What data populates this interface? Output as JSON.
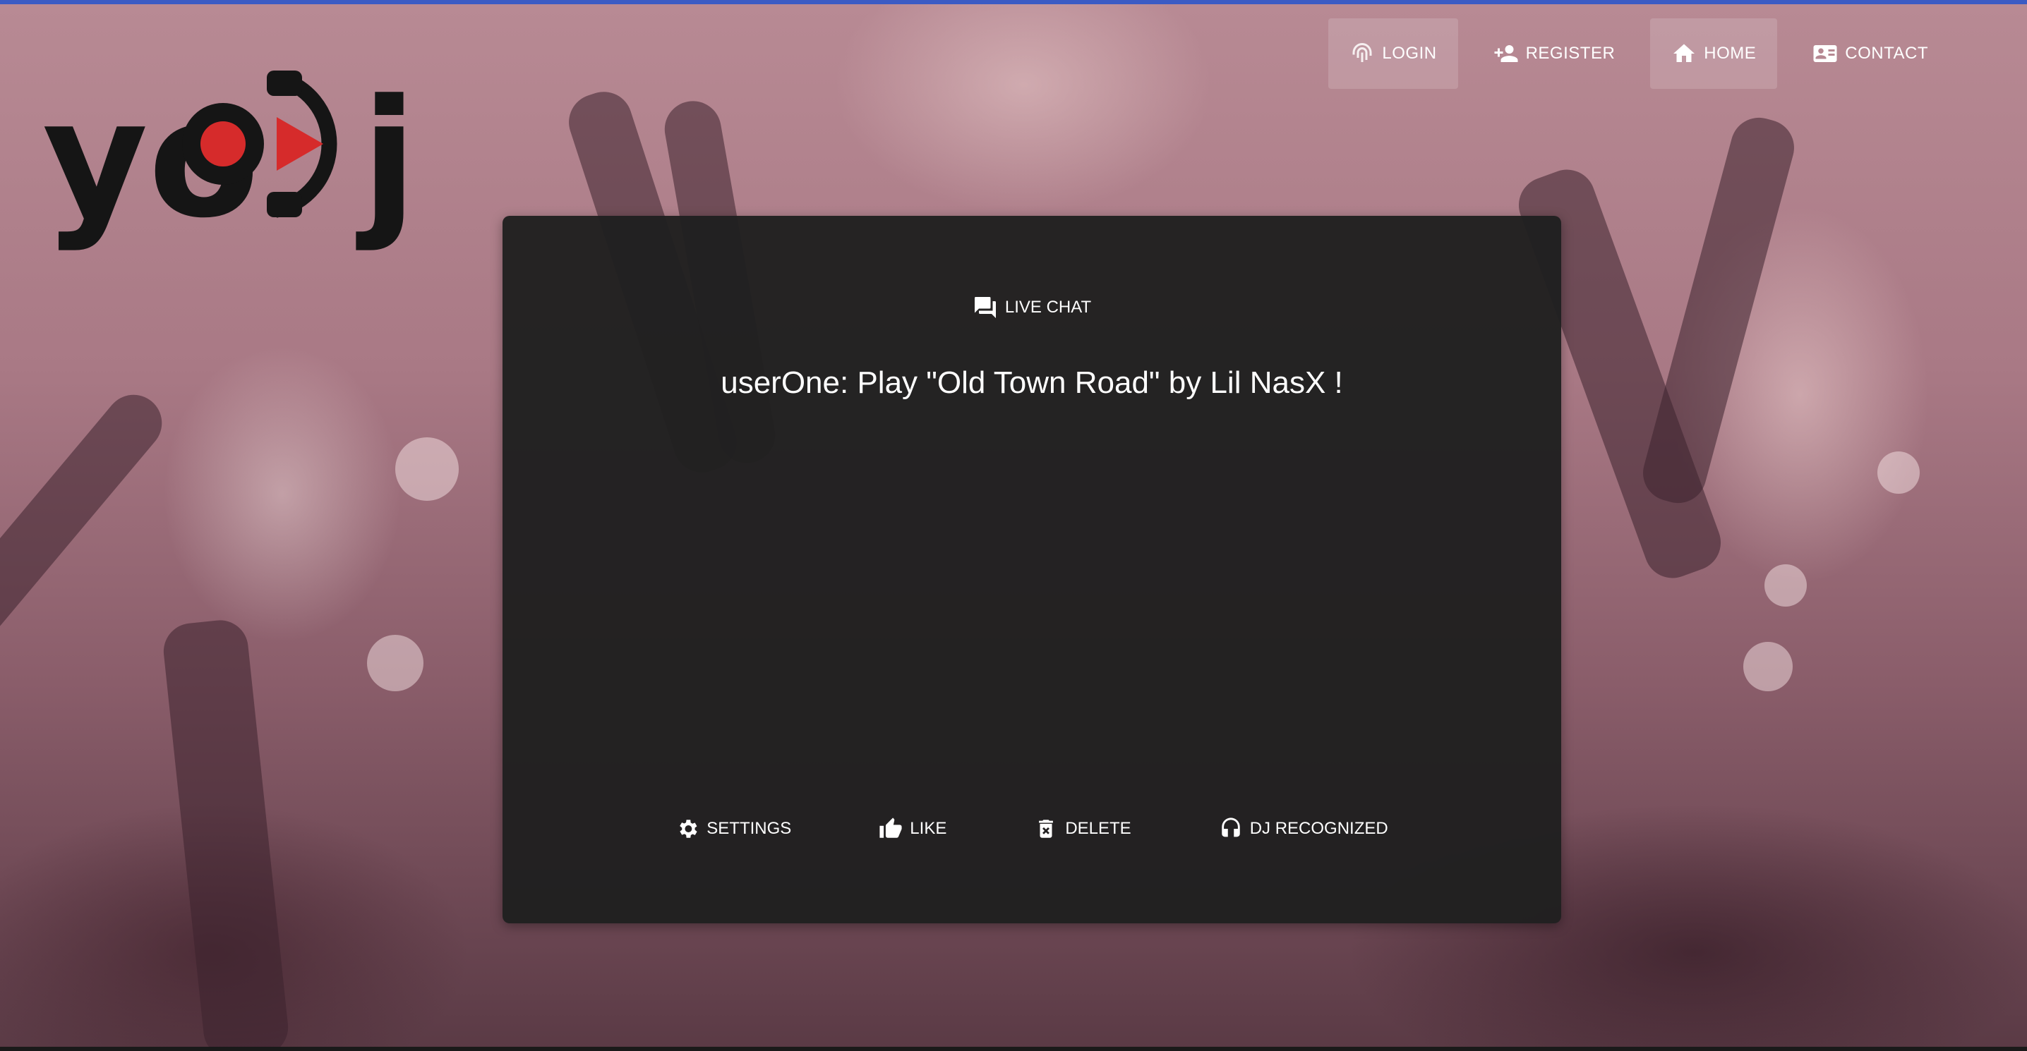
{
  "logo": {
    "text_left": "yo",
    "text_right": "j",
    "play_color": "#d62b2b",
    "dot_color": "#d62b2b"
  },
  "nav": {
    "items": [
      {
        "label": "LOGIN",
        "icon": "fingerprint-icon",
        "active": true
      },
      {
        "label": "REGISTER",
        "icon": "person-add-icon",
        "active": false
      },
      {
        "label": "HOME",
        "icon": "home-icon",
        "active": true
      },
      {
        "label": "CONTACT",
        "icon": "contact-card-icon",
        "active": false
      }
    ]
  },
  "card": {
    "header": {
      "label": "LIVE CHAT",
      "icon": "chat-icon"
    },
    "message": "userOne: Play \"Old Town Road\" by Lil NasX !",
    "actions": [
      {
        "label": "SETTINGS",
        "icon": "gear-icon"
      },
      {
        "label": "LIKE",
        "icon": "thumb-up-icon"
      },
      {
        "label": "DELETE",
        "icon": "trash-icon"
      },
      {
        "label": "DJ RECOGNIZED",
        "icon": "headphones-icon"
      }
    ]
  },
  "colors": {
    "top_strip": "#3b5bc4",
    "card_background": "#202020",
    "text": "#ffffff"
  }
}
